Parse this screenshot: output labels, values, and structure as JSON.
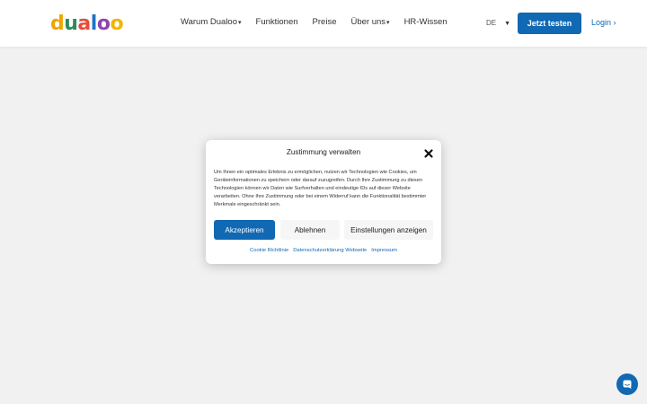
{
  "colors": {
    "brand_blue": "#1168b3",
    "page_bg": "#f1f1f1",
    "logo_letters": [
      "#f0a500",
      "#2e8b57",
      "#e74c3c",
      "#1a73c9",
      "#8e44ad",
      "#f4b400"
    ]
  },
  "logo": {
    "letters": [
      "d",
      "u",
      "a",
      "l",
      "o",
      "o"
    ]
  },
  "nav": {
    "items": [
      {
        "label": "Warum Dualoo",
        "has_caret": true
      },
      {
        "label": "Funktionen",
        "has_caret": false
      },
      {
        "label": "Preise",
        "has_caret": false
      },
      {
        "label": "Über uns",
        "has_caret": true
      },
      {
        "label": "HR-Wissen",
        "has_caret": false
      }
    ],
    "caret": "▾"
  },
  "header": {
    "language": "DE",
    "language_caret": "▼",
    "cta_label": "Jetzt testen",
    "login_label": "Login ›"
  },
  "consent": {
    "title": "Zustimmung verwalten",
    "body": "Um Ihnen ein optimales Erlebnis zu ermöglichen, nutzen wir Technologien wie Cookies, um Geräteinformationen zu speichern oder darauf zuzugreifen. Durch Ihre Zustimmung zu diesen Technologien können wir Daten wie Surfverhalten und eindeutige IDs auf dieser Website verarbeiten. Ohne Ihre Zustimmung oder bei einem Widerruf kann die Funktionalität bestimmter Merkmale eingeschränkt sein.",
    "accept_label": "Akzeptieren",
    "deny_label": "Ablehnen",
    "settings_label": "Einstellungen anzeigen",
    "links": [
      "Cookie Richtlinie",
      "Datenschutzerklärung Webseite",
      "Impressum"
    ]
  },
  "icons": {
    "close": "close-icon",
    "chat": "chat-icon",
    "caret": "chevron-down-icon"
  }
}
